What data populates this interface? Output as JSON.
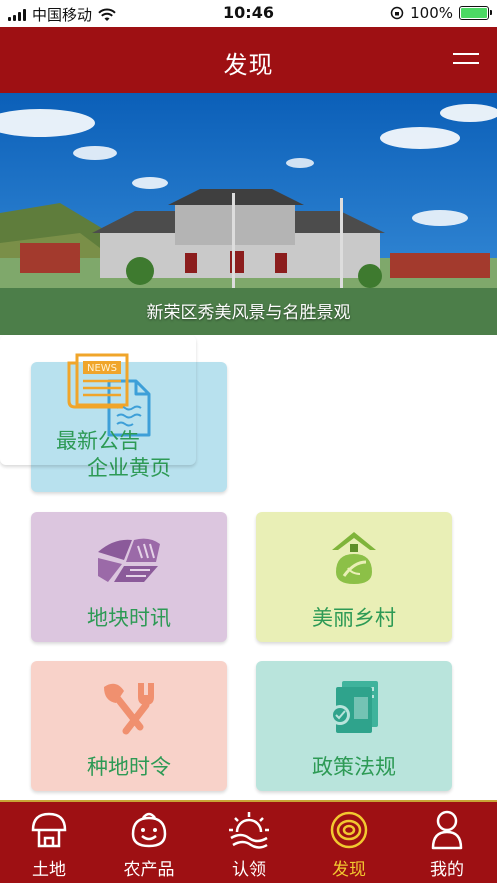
{
  "status_bar": {
    "carrier": "中国移动",
    "time": "10:46",
    "battery": "100%"
  },
  "nav": {
    "title": "发现",
    "menu_icon": "hamburger-menu-icon"
  },
  "banner": {
    "caption": "新荣区秀美风景与名胜景观"
  },
  "cards": [
    {
      "label": "企业黄页",
      "icon": "document-icon",
      "color": "#b8e1ee"
    },
    {
      "label": "最新公告",
      "icon": "newspaper-icon",
      "color": "#fbe3b0"
    },
    {
      "label": "地块时讯",
      "icon": "farmland-icon",
      "color": "#dcc6df"
    },
    {
      "label": "美丽乡村",
      "icon": "village-house-icon",
      "color": "#e9efb6"
    },
    {
      "label": "种地时令",
      "icon": "garden-tools-icon",
      "color": "#f8d2c9"
    },
    {
      "label": "政策法规",
      "icon": "policy-book-icon",
      "color": "#b9e4dc"
    }
  ],
  "tabs": [
    {
      "label": "土地",
      "icon": "mushroom-house-icon",
      "active": false
    },
    {
      "label": "农产品",
      "icon": "smile-icon",
      "active": false
    },
    {
      "label": "认领",
      "icon": "sunrise-icon",
      "active": false
    },
    {
      "label": "发现",
      "icon": "target-ring-icon",
      "active": true
    },
    {
      "label": "我的",
      "icon": "person-icon",
      "active": false
    }
  ],
  "colors": {
    "brand": "#9e1013",
    "card_text": "#2d9a55",
    "tab_active": "#f2c830"
  }
}
